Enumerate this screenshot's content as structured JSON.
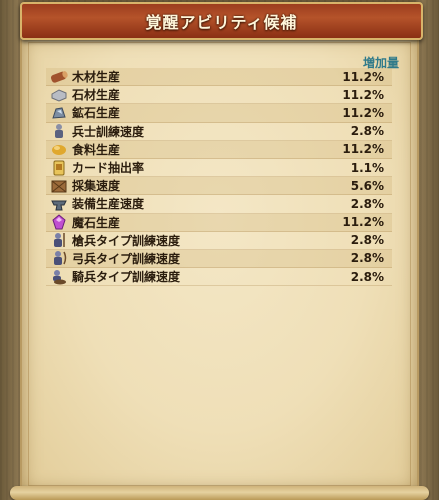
{
  "header": {
    "title": "覚醒アビリティ候補"
  },
  "table": {
    "column_header": "増加量",
    "rows": [
      {
        "label": "木材生産",
        "value": "11.2%",
        "icon": "wood-log-icon"
      },
      {
        "label": "石材生産",
        "value": "11.2%",
        "icon": "stone-block-icon"
      },
      {
        "label": "鉱石生産",
        "value": "11.2%",
        "icon": "ore-icon"
      },
      {
        "label": "兵士訓練速度",
        "value": "2.8%",
        "icon": "soldier-icon"
      },
      {
        "label": "食料生産",
        "value": "11.2%",
        "icon": "food-icon"
      },
      {
        "label": "カード抽出率",
        "value": "1.1%",
        "icon": "card-icon"
      },
      {
        "label": "採集速度",
        "value": "5.6%",
        "icon": "crate-icon"
      },
      {
        "label": "装備生産速度",
        "value": "2.8%",
        "icon": "anvil-icon"
      },
      {
        "label": "魔石生産",
        "value": "11.2%",
        "icon": "magic-stone-icon"
      },
      {
        "label": "槍兵タイプ訓練速度",
        "value": "2.8%",
        "icon": "spearman-icon"
      },
      {
        "label": "弓兵タイプ訓練速度",
        "value": "2.8%",
        "icon": "archer-icon"
      },
      {
        "label": "騎兵タイプ訓練速度",
        "value": "2.8%",
        "icon": "cavalry-icon"
      }
    ]
  }
}
